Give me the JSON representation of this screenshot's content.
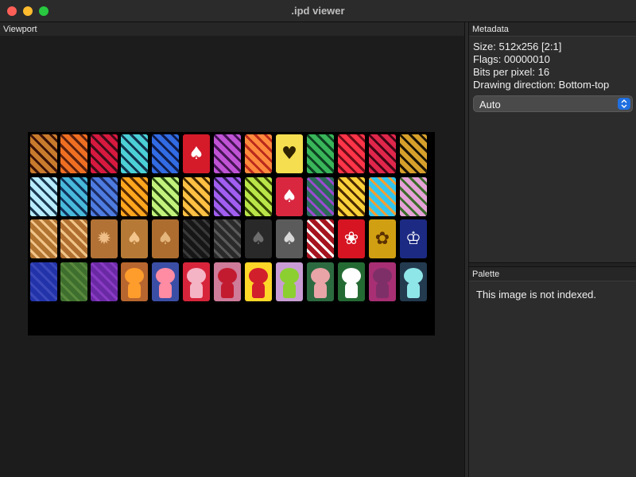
{
  "window": {
    "title": ".ipd viewer"
  },
  "viewport": {
    "label": "Viewport"
  },
  "metadata": {
    "label": "Metadata",
    "size": "Size: 512x256 [2:1]",
    "flags": "Flags: 00000010",
    "bpp": "Bits per pixel: 16",
    "direction": "Drawing direction: Bottom-top",
    "selected_option": "Auto"
  },
  "palette": {
    "label": "Palette",
    "message": "This image is not indexed."
  },
  "icons": {
    "close": "close-icon",
    "minimize": "minimize-icon",
    "zoom": "zoom-icon",
    "dropdown": "chevron-updown-icon"
  },
  "texture": {
    "rows": [
      [
        {
          "name": "ornate-pattern-brown",
          "colors": [
            "#c87b2c",
            "#3a1208"
          ]
        },
        {
          "name": "swirl-pattern-orange",
          "colors": [
            "#ef6f22",
            "#59200e"
          ]
        },
        {
          "name": "frame-pattern-red",
          "colors": [
            "#d7193f",
            "#3a0c18"
          ]
        },
        {
          "name": "knot-pattern-cyan",
          "colors": [
            "#4bd0d6",
            "#14314b"
          ]
        },
        {
          "name": "spiral-pattern-blue",
          "colors": [
            "#326ce5",
            "#101c4a"
          ]
        },
        {
          "name": "suit-pattern-red",
          "colors": [
            "#d51a2a",
            "#ffffff"
          ],
          "glyph": "♠"
        },
        {
          "name": "swirl-pattern-purple",
          "colors": [
            "#c053d5",
            "#451654"
          ]
        },
        {
          "name": "flame-pattern-orange",
          "colors": [
            "#ff8a3d",
            "#b92a1c"
          ]
        },
        {
          "name": "heart-pattern-yellow",
          "colors": [
            "#f5de4f",
            "#2e2201"
          ],
          "glyph": "♥"
        },
        {
          "name": "vine-pattern-green",
          "colors": [
            "#39b55a",
            "#0d4020"
          ]
        },
        {
          "name": "wave-pattern-red",
          "colors": [
            "#ff3448",
            "#6b0c18"
          ]
        },
        {
          "name": "arc-pattern-crimson",
          "colors": [
            "#e0264a",
            "#3f0515"
          ]
        },
        {
          "name": "cross-pattern-gold",
          "colors": [
            "#d6a02b",
            "#1c1404"
          ]
        }
      ],
      [
        {
          "name": "knot-pattern-light",
          "colors": [
            "#b8ecff",
            "#1a3950"
          ]
        },
        {
          "name": "swirl-pattern-cyan",
          "colors": [
            "#48b9da",
            "#10325a"
          ]
        },
        {
          "name": "circuit-pattern-blue",
          "colors": [
            "#4d7be0",
            "#1d2b61"
          ]
        },
        {
          "name": "knot-pattern-amber",
          "colors": [
            "#ffa61e",
            "#552900"
          ]
        },
        {
          "name": "knot-pattern-lime",
          "colors": [
            "#c2f27c",
            "#2b4d13"
          ]
        },
        {
          "name": "wave-pattern-gold",
          "colors": [
            "#ffc043",
            "#432a00"
          ]
        },
        {
          "name": "swirl-pattern-violet",
          "colors": [
            "#a15ef0",
            "#2f1a53"
          ]
        },
        {
          "name": "swirl-pattern-lime",
          "colors": [
            "#b9e548",
            "#364600"
          ]
        },
        {
          "name": "suit-pattern-crimson",
          "colors": [
            "#d9273f",
            "#ffffff"
          ],
          "glyph": "♠"
        },
        {
          "name": "diamond-pattern-navy",
          "colors": [
            "#2d6a5a",
            "#9a4bd0"
          ]
        },
        {
          "name": "chevron-pattern-yellow",
          "colors": [
            "#fbd23a",
            "#4a2a00"
          ]
        },
        {
          "name": "medallion-pattern-cyan",
          "colors": [
            "#34c6ef",
            "#f39f33"
          ]
        },
        {
          "name": "flower-pattern-pink",
          "colors": [
            "#e4a2d6",
            "#3b6b2b"
          ]
        }
      ],
      [
        {
          "name": "wood-card",
          "colors": [
            "#b17431",
            "#f1c58a"
          ]
        },
        {
          "name": "wood-card-apple",
          "colors": [
            "#b06f30",
            "#f0c488"
          ],
          "glyph": ""
        },
        {
          "name": "wood-card-sun",
          "colors": [
            "#b27236",
            "#efbe88"
          ],
          "glyph": "✹"
        },
        {
          "name": "wood-card-spade",
          "colors": [
            "#b67a36",
            "#f3c58d"
          ],
          "glyph": "♠"
        },
        {
          "name": "wood-card-spade-alt",
          "colors": [
            "#ad6d2f",
            "#e5b67c"
          ],
          "glyph": "♠"
        },
        {
          "name": "dark-card",
          "colors": [
            "#161616",
            "#3a3a3a"
          ]
        },
        {
          "name": "dark-card-apple",
          "colors": [
            "#2a2a2a",
            "#5a5a5a"
          ],
          "glyph": ""
        },
        {
          "name": "dark-card-spade",
          "colors": [
            "#292929",
            "#6d6d6d"
          ],
          "glyph": "♠"
        },
        {
          "name": "silver-card-spade",
          "colors": [
            "#5b5b5b",
            "#d9d9d9"
          ],
          "glyph": "♠"
        },
        {
          "name": "red-card-ornate",
          "colors": [
            "#a5141f",
            "#ffffff"
          ]
        },
        {
          "name": "red-card-flower",
          "colors": [
            "#d61422",
            "#ffffff"
          ],
          "glyph": "❀"
        },
        {
          "name": "gold-card-flower",
          "colors": [
            "#d19f12",
            "#5a3100"
          ],
          "glyph": "✿"
        },
        {
          "name": "blue-card-chess",
          "colors": [
            "#1c2a83",
            "#ffffff"
          ],
          "glyph": "♔"
        }
      ],
      [
        {
          "name": "blue-card-plain",
          "colors": [
            "#2233aa",
            "#3c49b9"
          ]
        },
        {
          "name": "green-card-plain",
          "colors": [
            "#3e6f2e",
            "#5b8a3e"
          ]
        },
        {
          "name": "purple-card-plain",
          "colors": [
            "#6a2aa4",
            "#8a3bc4"
          ]
        },
        {
          "name": "character-orange",
          "colors": [
            "#b8662f",
            "#ff9d2c"
          ],
          "character": true
        },
        {
          "name": "character-blue",
          "colors": [
            "#3b4ea6",
            "#ff8ca3"
          ],
          "character": true
        },
        {
          "name": "character-red",
          "colors": [
            "#d7243b",
            "#f4b4c5"
          ],
          "character": true
        },
        {
          "name": "character-pink",
          "colors": [
            "#cf7b9a",
            "#c21b2f"
          ],
          "character": true
        },
        {
          "name": "character-yellow",
          "colors": [
            "#ffd728",
            "#d21f2c"
          ],
          "character": true
        },
        {
          "name": "character-lilac",
          "colors": [
            "#c99dd4",
            "#8ccf30"
          ],
          "character": true
        },
        {
          "name": "character-green",
          "colors": [
            "#2c6a40",
            "#e9a4a8"
          ],
          "character": true
        },
        {
          "name": "character-darkgreen",
          "colors": [
            "#246a33",
            "#fefefe"
          ],
          "character": true
        },
        {
          "name": "character-magenta",
          "colors": [
            "#a82f73",
            "#7f2f68"
          ],
          "character": true
        },
        {
          "name": "character-teal",
          "colors": [
            "#233a4f",
            "#8fe6e8"
          ],
          "character": true
        }
      ]
    ]
  }
}
